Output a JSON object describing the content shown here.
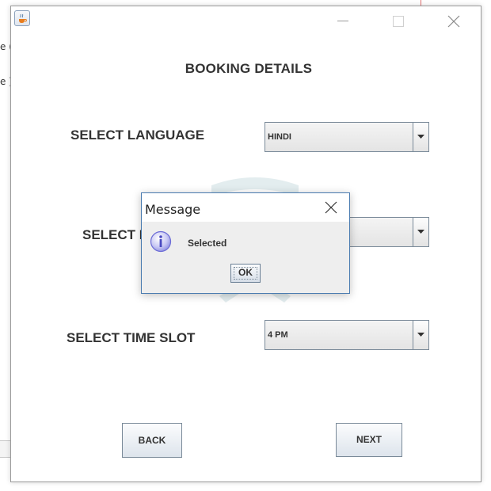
{
  "background_window": {
    "fragments": [
      "e (",
      "e )"
    ]
  },
  "window": {
    "app_icon": "java-icon",
    "controls": [
      "minimize-icon",
      "maximize-icon",
      "close-icon"
    ]
  },
  "form": {
    "heading": "BOOKING DETAILS",
    "language_label": "SELECT LANGUAGE",
    "language_value": "HINDI",
    "second_label": "SELECT I",
    "second_value": "",
    "time_slot_label": "SELECT TIME SLOT",
    "time_slot_value": "4 PM",
    "back_label": "BACK",
    "next_label": "NEXT"
  },
  "dialog": {
    "title": "Message",
    "icon": "info-icon",
    "message": "Selected",
    "ok_label": "OK"
  },
  "colors": {
    "dialog_border": "#4a7bb0",
    "info_icon": "#6b6bd6"
  }
}
